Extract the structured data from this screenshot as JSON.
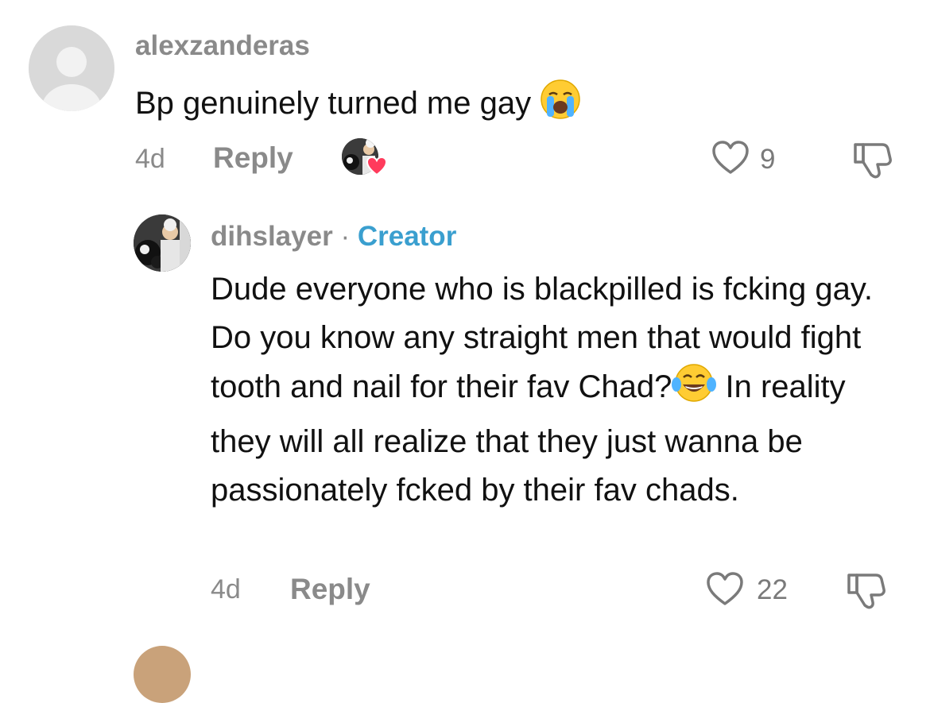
{
  "comments": [
    {
      "username": "alexzanderas",
      "text": "Bp genuinely turned me gay",
      "emoji": "loudly-crying-face",
      "time": "4d",
      "reply_label": "Reply",
      "likes": "9",
      "creator_liked": true
    },
    {
      "username": "dihslayer",
      "separator": "·",
      "badge": "Creator",
      "text_part1": "Dude everyone who is blackpilled is fcking gay. Do you know any straight men that would fight tooth and nail for their fav Chad?",
      "emoji": "face-with-tears-of-joy",
      "text_part2": " In reality they will all realize that they just wanna be passionately fcked by their fav chads.",
      "time": "4d",
      "reply_label": "Reply",
      "likes": "22"
    }
  ],
  "icons": {
    "like": "heart-outline-icon",
    "dislike": "thumbs-down-outline-icon",
    "creator_like_badge": "heart-filled-icon"
  },
  "colors": {
    "username": "#8a8a8a",
    "creator_badge": "#3a9fcf",
    "heart_badge": "#ff3b5c",
    "text": "#111111",
    "icon_stroke": "#7a7a7a"
  }
}
